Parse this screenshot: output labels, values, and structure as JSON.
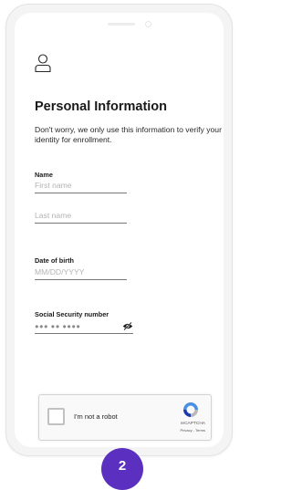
{
  "form": {
    "title": "Personal Information",
    "subtitle": "Don't worry, we only use this information to verify your identity for enrollment."
  },
  "fields": {
    "name_label": "Name",
    "first_name_placeholder": "First name",
    "last_name_placeholder": "Last name",
    "dob_label": "Date of birth",
    "dob_placeholder": "MM/DD/YYYY",
    "ssn_label": "Social Security number",
    "ssn_placeholder": "●●● ●● ●●●●"
  },
  "recaptcha": {
    "label": "I'm not a robot",
    "brand": "reCAPTCHA",
    "links": "Privacy - Terms"
  },
  "step": {
    "number": "2"
  },
  "colors": {
    "accent": "#5b2fbf",
    "text": "#1a1a1a",
    "placeholder": "#b3b3b3"
  },
  "icons": {
    "user": "user-outline-icon",
    "visibility": "eye-slash-icon",
    "recaptcha": "recaptcha-logo-icon"
  }
}
